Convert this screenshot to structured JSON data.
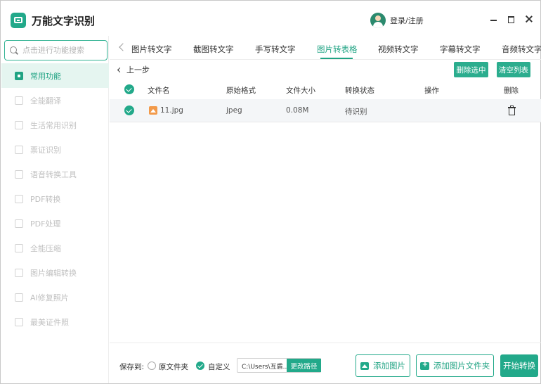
{
  "app": {
    "title": "万能文字识别",
    "login_label": "登录/注册"
  },
  "sidebar": {
    "search_placeholder": "点击进行功能搜索",
    "items": [
      {
        "label": "常用功能",
        "active": true
      },
      {
        "label": "全能翻译"
      },
      {
        "label": "生活常用识别"
      },
      {
        "label": "票证识别"
      },
      {
        "label": "语音转换工具"
      },
      {
        "label": "PDF转换"
      },
      {
        "label": "PDF处理"
      },
      {
        "label": "全能压缩"
      },
      {
        "label": "图片编辑转换"
      },
      {
        "label": "AI修复照片"
      },
      {
        "label": "最美证件照"
      }
    ]
  },
  "tabs": [
    "图片转文字",
    "截图转文字",
    "手写转文字",
    "图片转表格",
    "视频转文字",
    "字幕转文字",
    "音频转文字"
  ],
  "active_tab": "图片转表格",
  "content": {
    "back_label": "上一步",
    "delete_selected_label": "删除选中",
    "clear_list_label": "清空列表",
    "columns": {
      "filename": "文件名",
      "format": "原始格式",
      "size": "文件大小",
      "status": "转换状态",
      "action": "操作",
      "delete": "删除"
    },
    "rows": [
      {
        "filename": "11.jpg",
        "format": "jpeg",
        "size": "0.08M",
        "status": "待识别"
      }
    ]
  },
  "footer": {
    "save_to_label": "保存到:",
    "option_original": "原文件夹",
    "option_custom": "自定义",
    "path_value": "C:\\Users\\互盾...",
    "change_path_label": "更改路径",
    "add_image_label": "添加图片",
    "add_folder_label": "添加图片文件夹",
    "start_label": "开始转换"
  },
  "colors": {
    "accent": "#22a98a",
    "active_bg": "#e5f5f0"
  }
}
